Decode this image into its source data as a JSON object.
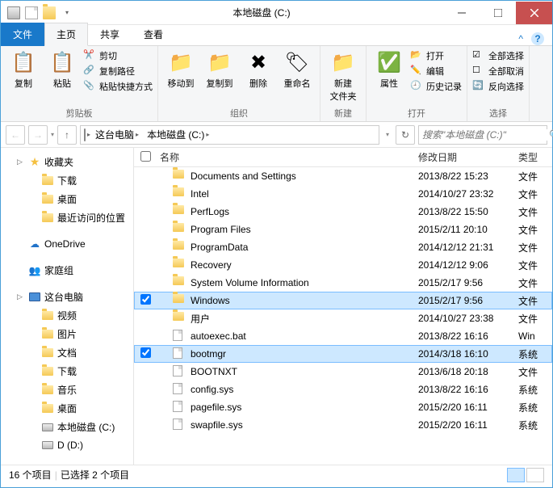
{
  "window": {
    "title": "本地磁盘 (C:)"
  },
  "tabs": {
    "file": "文件",
    "items": [
      "主页",
      "共享",
      "查看"
    ],
    "active": 0
  },
  "ribbon": {
    "groups": [
      {
        "label": "剪贴板",
        "big": [
          {
            "id": "copy",
            "label": "复制"
          },
          {
            "id": "paste",
            "label": "粘贴"
          }
        ],
        "small": [
          {
            "id": "cut",
            "label": "剪切"
          },
          {
            "id": "copypath",
            "label": "复制路径"
          },
          {
            "id": "pasteshortcut",
            "label": "粘贴快捷方式"
          }
        ]
      },
      {
        "label": "组织",
        "big": [
          {
            "id": "moveto",
            "label": "移动到"
          },
          {
            "id": "copyto",
            "label": "复制到"
          },
          {
            "id": "delete",
            "label": "删除"
          },
          {
            "id": "rename",
            "label": "重命名"
          }
        ]
      },
      {
        "label": "新建",
        "big": [
          {
            "id": "newfolder",
            "label": "新建\n文件夹"
          }
        ]
      },
      {
        "label": "打开",
        "big": [
          {
            "id": "properties",
            "label": "属性"
          }
        ],
        "small": [
          {
            "id": "open",
            "label": "打开"
          },
          {
            "id": "edit",
            "label": "编辑"
          },
          {
            "id": "history",
            "label": "历史记录"
          }
        ]
      },
      {
        "label": "选择",
        "small": [
          {
            "id": "selectall",
            "label": "全部选择"
          },
          {
            "id": "selectnone",
            "label": "全部取消"
          },
          {
            "id": "invert",
            "label": "反向选择"
          }
        ]
      }
    ]
  },
  "breadcrumb": {
    "items": [
      "这台电脑",
      "本地磁盘 (C:)"
    ]
  },
  "search": {
    "placeholder": "搜索\"本地磁盘 (C:)\""
  },
  "sidebar": {
    "groups": [
      {
        "label": "收藏夹",
        "icon": "star",
        "children": [
          {
            "label": "下载",
            "icon": "folder"
          },
          {
            "label": "桌面",
            "icon": "folder"
          },
          {
            "label": "最近访问的位置",
            "icon": "folder"
          }
        ]
      },
      {
        "label": "OneDrive",
        "icon": "cloud",
        "children": []
      },
      {
        "label": "家庭组",
        "icon": "homegroup",
        "children": []
      },
      {
        "label": "这台电脑",
        "icon": "computer",
        "children": [
          {
            "label": "视频",
            "icon": "folder"
          },
          {
            "label": "图片",
            "icon": "folder"
          },
          {
            "label": "文档",
            "icon": "folder"
          },
          {
            "label": "下载",
            "icon": "folder"
          },
          {
            "label": "音乐",
            "icon": "folder"
          },
          {
            "label": "桌面",
            "icon": "folder"
          },
          {
            "label": "本地磁盘 (C:)",
            "icon": "drive"
          },
          {
            "label": "D (D:)",
            "icon": "drive"
          }
        ]
      }
    ]
  },
  "columns": {
    "name": "名称",
    "date": "修改日期",
    "type": "类型"
  },
  "files": [
    {
      "name": "Documents and Settings",
      "date": "2013/8/22 15:23",
      "type": "文件",
      "icon": "folder",
      "selected": false
    },
    {
      "name": "Intel",
      "date": "2014/10/27 23:32",
      "type": "文件",
      "icon": "folder",
      "selected": false
    },
    {
      "name": "PerfLogs",
      "date": "2013/8/22 15:50",
      "type": "文件",
      "icon": "folder",
      "selected": false
    },
    {
      "name": "Program Files",
      "date": "2015/2/11 20:10",
      "type": "文件",
      "icon": "folder",
      "selected": false
    },
    {
      "name": "ProgramData",
      "date": "2014/12/12 21:31",
      "type": "文件",
      "icon": "folder",
      "selected": false
    },
    {
      "name": "Recovery",
      "date": "2014/12/12 9:06",
      "type": "文件",
      "icon": "folder",
      "selected": false
    },
    {
      "name": "System Volume Information",
      "date": "2015/2/17 9:56",
      "type": "文件",
      "icon": "folder",
      "selected": false
    },
    {
      "name": "Windows",
      "date": "2015/2/17 9:56",
      "type": "文件",
      "icon": "folder",
      "selected": true
    },
    {
      "name": "用户",
      "date": "2014/10/27 23:38",
      "type": "文件",
      "icon": "folder",
      "selected": false
    },
    {
      "name": "autoexec.bat",
      "date": "2013/8/22 16:16",
      "type": "Win",
      "icon": "file",
      "selected": false
    },
    {
      "name": "bootmgr",
      "date": "2014/3/18 16:10",
      "type": "系统",
      "icon": "file",
      "selected": true
    },
    {
      "name": "BOOTNXT",
      "date": "2013/6/18 20:18",
      "type": "文件",
      "icon": "file",
      "selected": false
    },
    {
      "name": "config.sys",
      "date": "2013/8/22 16:16",
      "type": "系统",
      "icon": "file",
      "selected": false
    },
    {
      "name": "pagefile.sys",
      "date": "2015/2/20 16:11",
      "type": "系统",
      "icon": "file",
      "selected": false
    },
    {
      "name": "swapfile.sys",
      "date": "2015/2/20 16:11",
      "type": "系统",
      "icon": "file",
      "selected": false
    }
  ],
  "status": {
    "count": "16 个项目",
    "selected": "已选择 2 个项目"
  }
}
